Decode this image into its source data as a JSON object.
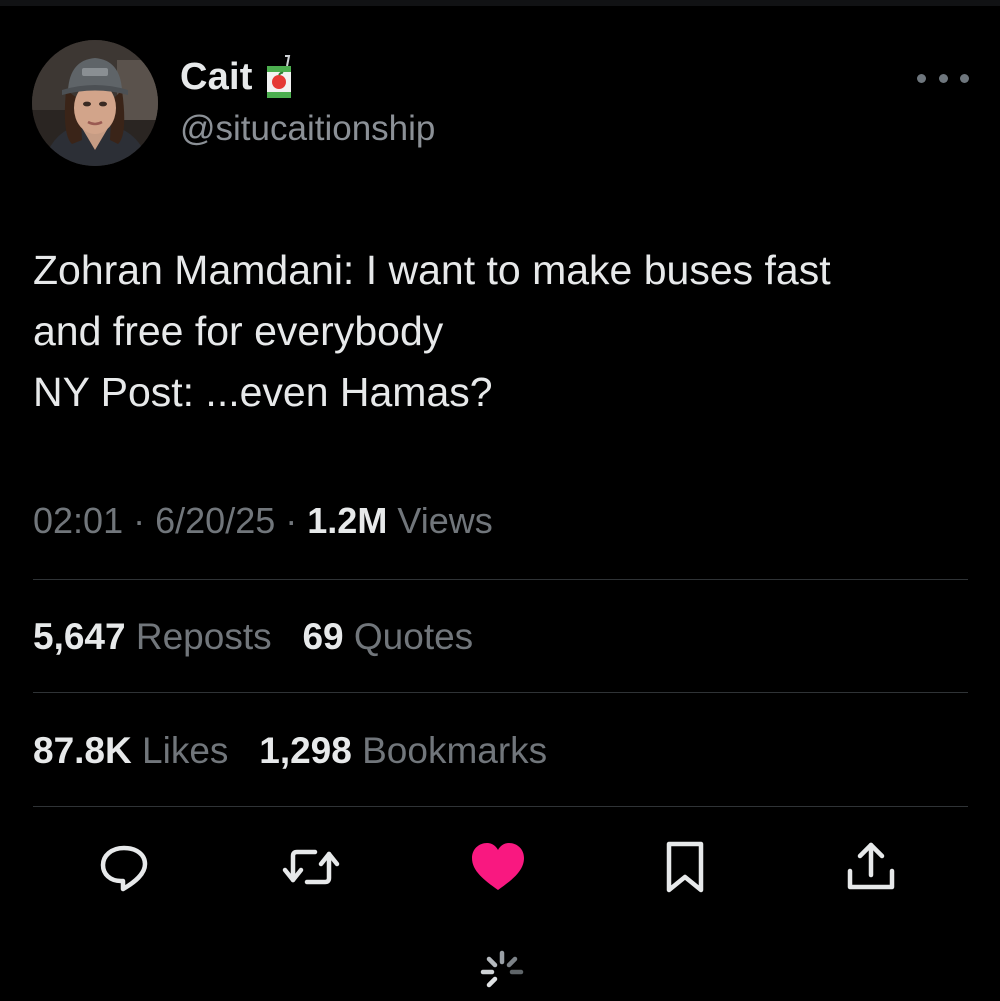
{
  "user": {
    "display_name": "Cait",
    "name_emoji": "juice-box-emoji",
    "handle": "@situcaitionship"
  },
  "tweet": {
    "lines": [
      "Zohran Mamdani: I want to make buses fast",
      "and free for everybody",
      "NY Post: ...even Hamas?"
    ]
  },
  "meta": {
    "time": "02:01",
    "separator": "·",
    "date": "6/20/25",
    "views_count": "1.2M",
    "views_label": "Views"
  },
  "stats": {
    "reposts_count": "5,647",
    "reposts_label": "Reposts",
    "quotes_count": "69",
    "quotes_label": "Quotes",
    "likes_count": "87.8K",
    "likes_label": "Likes",
    "bookmarks_count": "1,298",
    "bookmarks_label": "Bookmarks"
  },
  "actions": [
    {
      "name": "reply",
      "icon": "speech-bubble-icon"
    },
    {
      "name": "repost",
      "icon": "repost-icon"
    },
    {
      "name": "like",
      "icon": "heart-icon",
      "active": true
    },
    {
      "name": "bookmark",
      "icon": "bookmark-icon"
    },
    {
      "name": "share",
      "icon": "share-icon"
    }
  ],
  "colors": {
    "background": "#000000",
    "text_primary": "#e7e9ea",
    "text_secondary": "#71767b",
    "divider": "#2f3336",
    "like_active": "#f91880"
  }
}
